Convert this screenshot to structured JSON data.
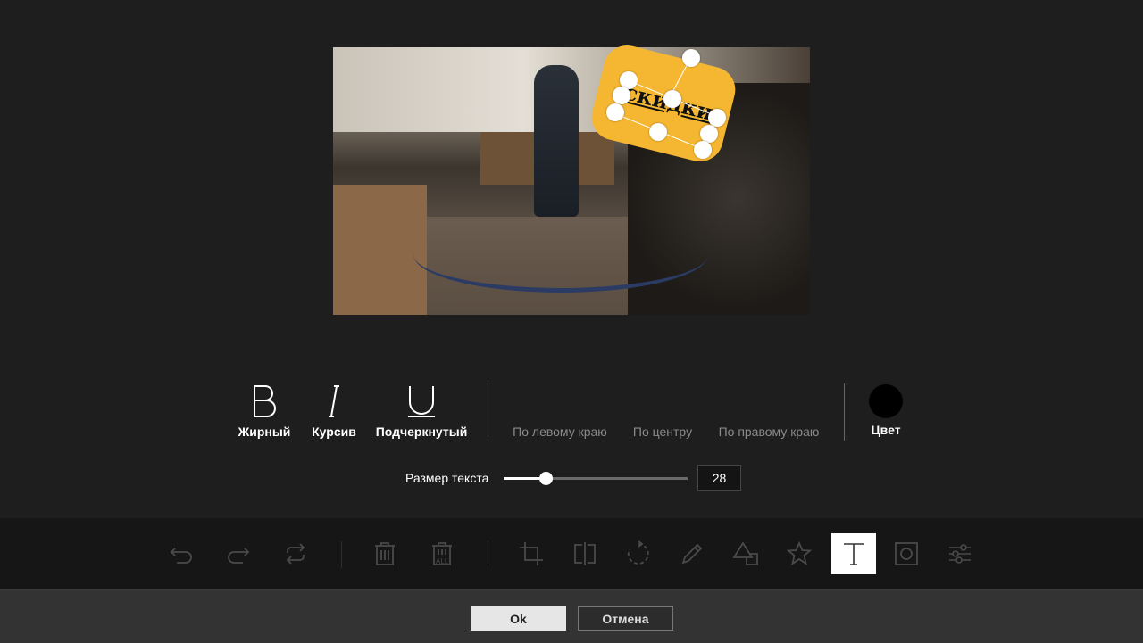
{
  "sticker": {
    "text": "скидки"
  },
  "text_style": {
    "bold_label": "Жирный",
    "italic_label": "Курсив",
    "underline_label": "Подчеркнутый",
    "align_left_label": "По левому краю",
    "align_center_label": "По центру",
    "align_right_label": "По правому краю",
    "color_label": "Цвет",
    "color_value": "#000000"
  },
  "text_size": {
    "label": "Размер текста",
    "value": "28",
    "slider_fraction": 0.23
  },
  "toolbar": {
    "tools": [
      "undo-icon",
      "redo-icon",
      "reset-icon",
      "delete-icon",
      "delete-all-icon",
      "crop-icon",
      "flip-icon",
      "rotate-icon",
      "draw-icon",
      "shape-icon",
      "icon-icon",
      "text-icon",
      "mask-icon",
      "filter-icon"
    ],
    "active_tool": "text-icon",
    "delete_all_caption": "ALL"
  },
  "buttons": {
    "ok": "Ok",
    "cancel": "Отмена"
  },
  "colors": {
    "accent": "#f5b731",
    "background": "#1e1e1e"
  }
}
